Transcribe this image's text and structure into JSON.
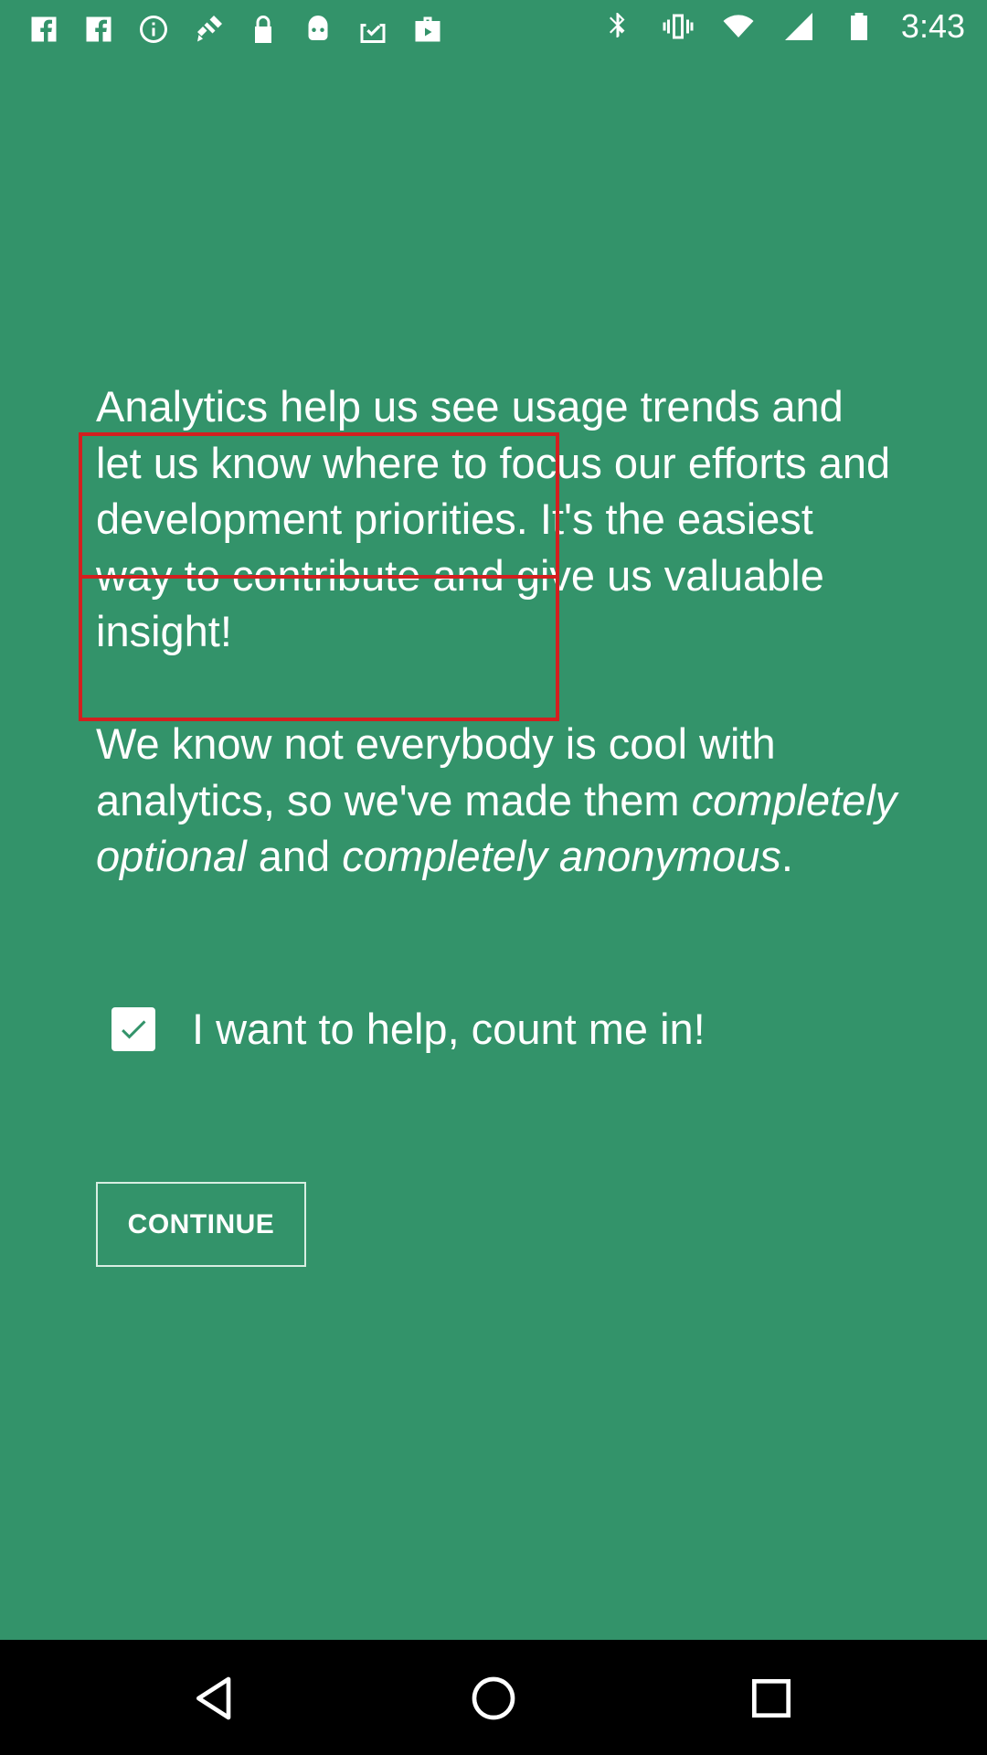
{
  "status_bar": {
    "time": "3:43",
    "left_icons": [
      "facebook-icon",
      "facebook-icon",
      "info-icon",
      "fake-gps-icon",
      "lock-icon",
      "android-icon",
      "clipboard-check-icon",
      "briefcase-icon"
    ],
    "right_icons": [
      "bluetooth-icon",
      "vibrate-icon",
      "wifi-icon",
      "signal-icon",
      "battery-icon"
    ]
  },
  "main": {
    "paragraph1": "Analytics help us see usage trends and let us know where to focus our efforts and development priorities. It's the easiest way to contribute and give us valuable insight!",
    "paragraph2": {
      "part1": "We know not everybody is cool with analytics, so we've made them ",
      "emph1": "completely optional",
      "part2": " and ",
      "emph2": "completely anonymous",
      "part3": "."
    },
    "checkbox_label": "I want to help, count me in!",
    "checkbox_checked": true,
    "continue_label": "CONTINUE"
  },
  "colors": {
    "background": "#33936a",
    "annotation_red": "#d31f1f"
  },
  "nav_bar": {
    "buttons": [
      "back-icon",
      "home-icon",
      "recent-apps-icon"
    ]
  }
}
